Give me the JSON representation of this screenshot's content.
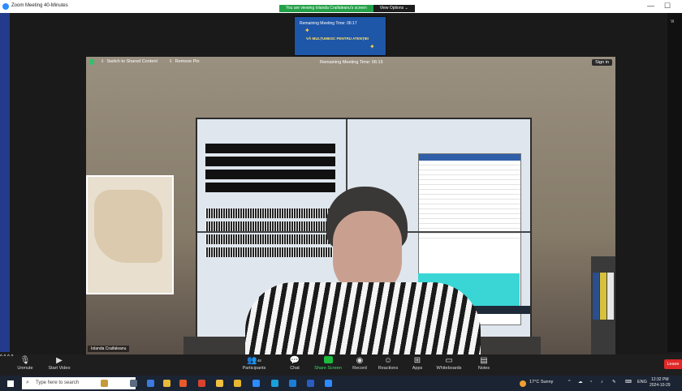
{
  "window": {
    "title": "Zoom Meeting 40-Minutes",
    "controls": {
      "minimize": "—",
      "maximize": "☐"
    }
  },
  "share_banner": {
    "message": "You are viewing Iolanda Craifaleanu's screen",
    "options_label": "View Options",
    "options_caret": "⌄"
  },
  "thumbnail": {
    "remaining": "Remaining Meeting Time: 06:17",
    "slide_text": "VĂ MULȚUMESC PENTRU ATENȚIE!"
  },
  "right_strip": {
    "label": "Vi"
  },
  "video": {
    "switch_label": "Switch to Shared Content",
    "remove_pin_label": "Remove Pin",
    "remaining": "Remaining Meeting Time: 06:15",
    "sign_in": "Sign in",
    "participant_name": "Iolanda Craifaleanu"
  },
  "controls": {
    "unmute": "Unmute",
    "start_video": "Start Video",
    "participants": "Participants",
    "participants_count": "48",
    "chat": "Chat",
    "share_screen": "Share Screen",
    "record": "Record",
    "reactions": "Reactions",
    "apps": "Apps",
    "whiteboards": "Whiteboards",
    "notes": "Notes",
    "leave": "Leave",
    "caret": "^"
  },
  "taskbar": {
    "search_placeholder": "Type here to search",
    "weather": "17°C  Sunny",
    "language": "ENG",
    "time": "12:32 PM",
    "date": "2024-10-29"
  },
  "colors": {
    "share_green": "#24a148",
    "leave_red": "#e02828",
    "taskbar": "#1b2433",
    "zoom_blue": "#2d8cff"
  }
}
